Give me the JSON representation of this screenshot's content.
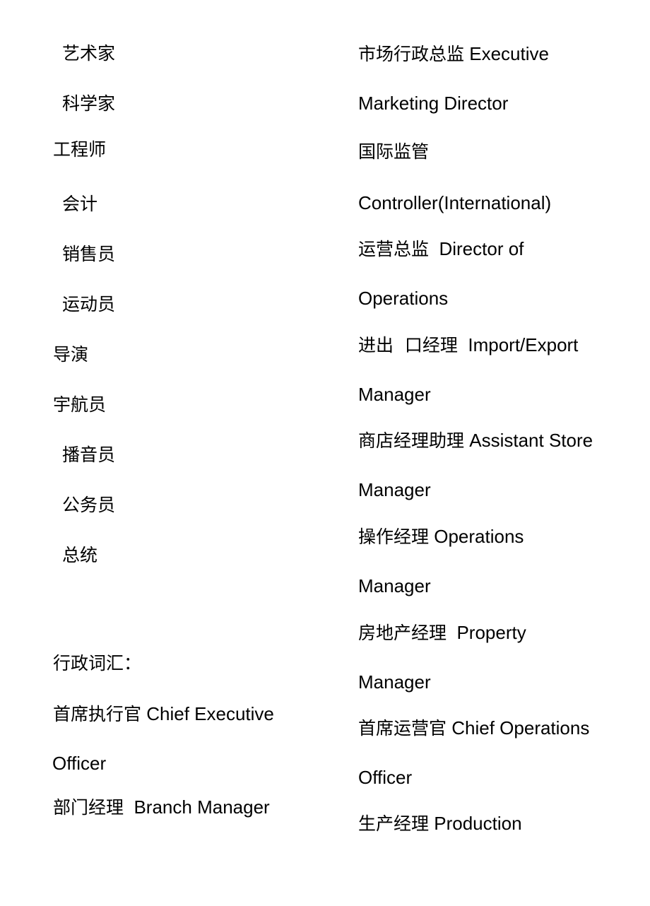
{
  "left_column": {
    "occupations": [
      "艺术家",
      "科学家",
      "工程师",
      "会计",
      "销售员",
      "运动员",
      "导演",
      "宇航员",
      "播音员",
      "公务员",
      "总统"
    ],
    "section_heading": "行政词汇：",
    "entries": [
      {
        "zh": "首席执行官",
        "en_line1": "Chief Executive",
        "en_line2": "Officer"
      },
      {
        "zh": "部门经理",
        "en_line1": "Branch Manager",
        "en_line2": ""
      }
    ]
  },
  "right_column": {
    "entries": [
      {
        "zh": "市场行政总监",
        "en_line1": "Executive",
        "en_line2": "Marketing Director"
      },
      {
        "zh": "国际监管",
        "en_line1": "",
        "en_line2": "Controller(International)"
      },
      {
        "zh": "运营总监",
        "en_line1": "Director of",
        "en_line2": "Operations"
      },
      {
        "zh": "进出  口经理",
        "en_line1": "Import/Export",
        "en_line2": "Manager"
      },
      {
        "zh": "商店经理助理",
        "en_line1": "Assistant Store",
        "en_line2": "Manager"
      },
      {
        "zh": "操作经理",
        "en_line1": "Operations",
        "en_line2": "Manager"
      },
      {
        "zh": "房地产经理",
        "en_line1": "Property",
        "en_line2": "Manager"
      },
      {
        "zh": "首席运营官",
        "en_line1": "Chief Operations",
        "en_line2": "Officer"
      },
      {
        "zh": "生产经理",
        "en_line1": "Production",
        "en_line2": ""
      }
    ]
  }
}
